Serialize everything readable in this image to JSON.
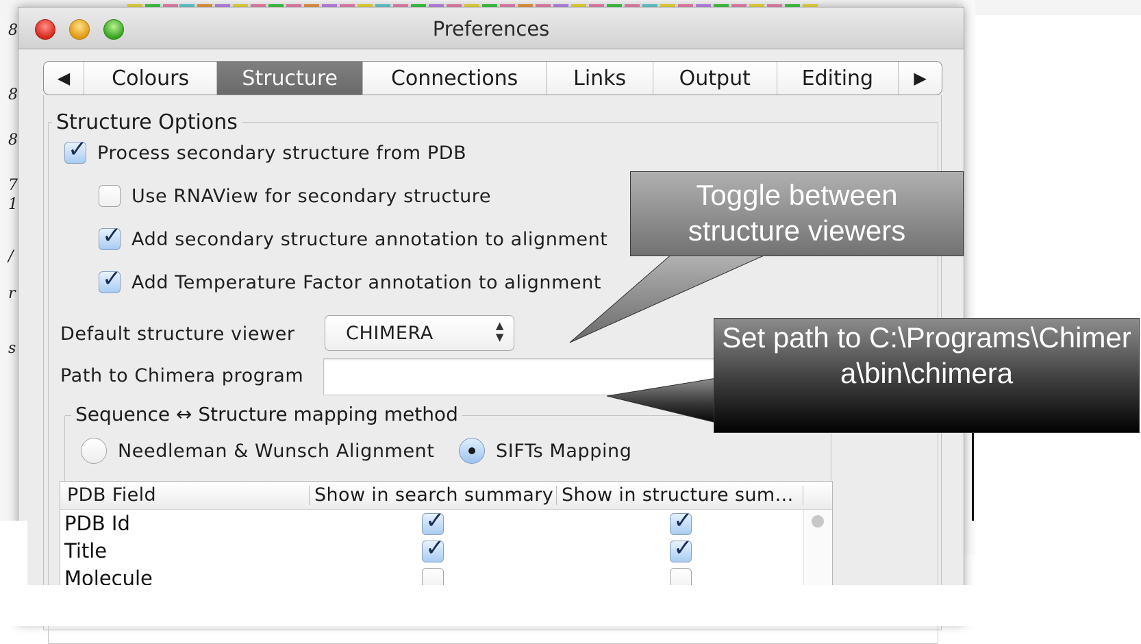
{
  "window": {
    "title": "Preferences"
  },
  "tabs": [
    {
      "label": "◀"
    },
    {
      "label": "Colours"
    },
    {
      "label": "Structure",
      "active": true
    },
    {
      "label": "Connections"
    },
    {
      "label": "Links"
    },
    {
      "label": "Output"
    },
    {
      "label": "Editing"
    },
    {
      "label": "▶"
    }
  ],
  "structure": {
    "group_title": "Structure Options",
    "process_ss": {
      "label": "Process secondary structure from PDB",
      "checked": true
    },
    "use_rnaview": {
      "label": "Use RNAView for secondary structure",
      "checked": false
    },
    "add_ss_annotation": {
      "label": "Add secondary structure annotation to alignment",
      "checked": true
    },
    "add_temp_annotation": {
      "label": "Add Temperature Factor annotation to alignment",
      "checked": true
    },
    "default_viewer_label": "Default structure viewer",
    "default_viewer_value": "CHIMERA",
    "chimera_path_label": "Path to Chimera program",
    "chimera_path_value": ""
  },
  "mapping": {
    "group_title": "Sequence ↔ Structure mapping method",
    "options": [
      {
        "label": "Needleman & Wunsch Alignment",
        "selected": false
      },
      {
        "label": "SIFTs Mapping",
        "selected": true
      }
    ]
  },
  "pdb_table": {
    "columns": [
      "PDB Field",
      "Show in search summary",
      "Show in structure sum..."
    ],
    "rows": [
      {
        "field": "PDB Id",
        "search": true,
        "structure": true
      },
      {
        "field": "Title",
        "search": true,
        "structure": true
      },
      {
        "field": "Molecule",
        "search": false,
        "structure": false
      }
    ]
  },
  "callouts": {
    "viewer": "Toggle between structure viewers",
    "path": "Set path to C:\\Programs\\Chimera\\bin\\chimera"
  },
  "icons": {
    "check": "check-icon",
    "select_arrows": "updown-chevron-icon",
    "prev": "left-arrow-icon",
    "next": "right-arrow-icon"
  }
}
